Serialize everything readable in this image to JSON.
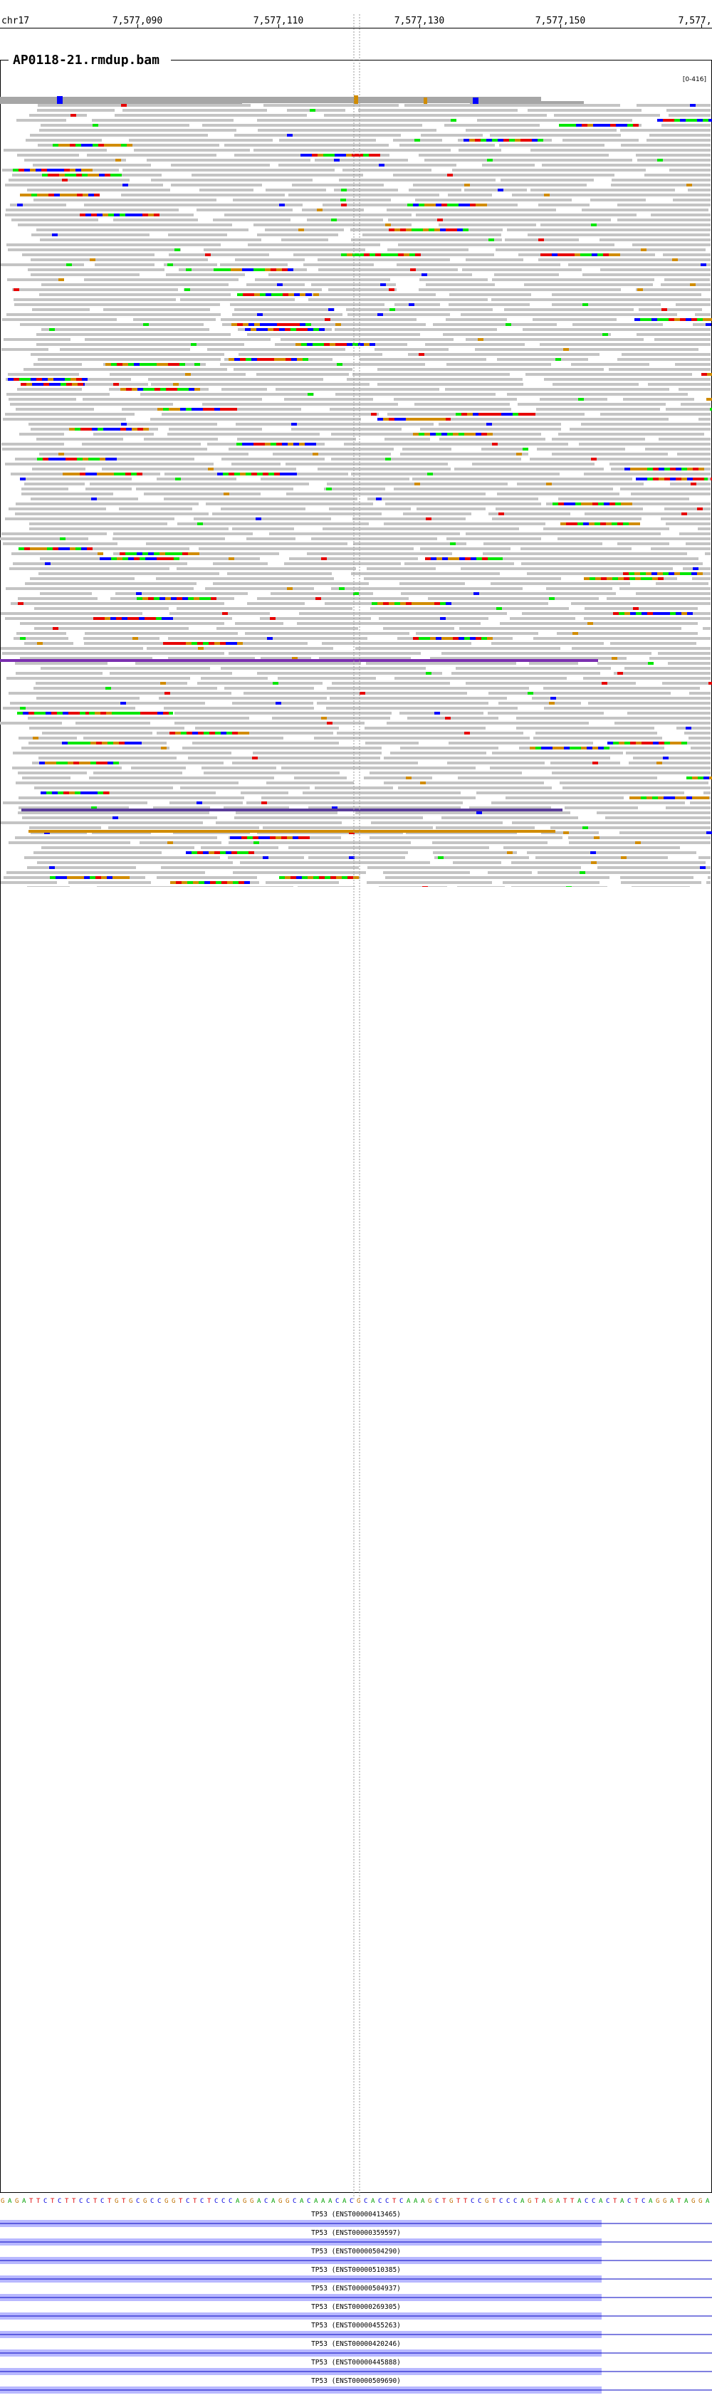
{
  "ruler": {
    "chromosome": "chr17",
    "ticks": [
      "7,577,090",
      "7,577,110",
      "7,577,130",
      "7,577,150",
      "7,577,1"
    ]
  },
  "track": {
    "title": "AP0118-21.rmdup.bam",
    "coverage_range": "[0-416]"
  },
  "colors": {
    "read": "#c4c4c4",
    "A": "#00e600",
    "C": "#0000ff",
    "G": "#d18c00",
    "T": "#e60000",
    "insertion": "#7b2fb0",
    "exon": "#b8b8ff"
  },
  "reference_sequence": "GAGATTCTCTTCCTCTGTGCGCCGGTCTCTCCCAGGACAGGCACAAACACGCACCTCAAAGCTGTTCCGTCCCAGTAGATTACCACTACTCAGGATAGGA",
  "transcripts": [
    "TP53 (ENST00000413465)",
    "TP53 (ENST00000359597)",
    "TP53 (ENST00000504290)",
    "TP53 (ENST00000510385)",
    "TP53 (ENST00000504937)",
    "TP53 (ENST00000269305)",
    "TP53 (ENST00000455263)",
    "TP53 (ENST00000420246)",
    "TP53 (ENST00000445888)",
    "TP53 (ENST00000509690)"
  ]
}
